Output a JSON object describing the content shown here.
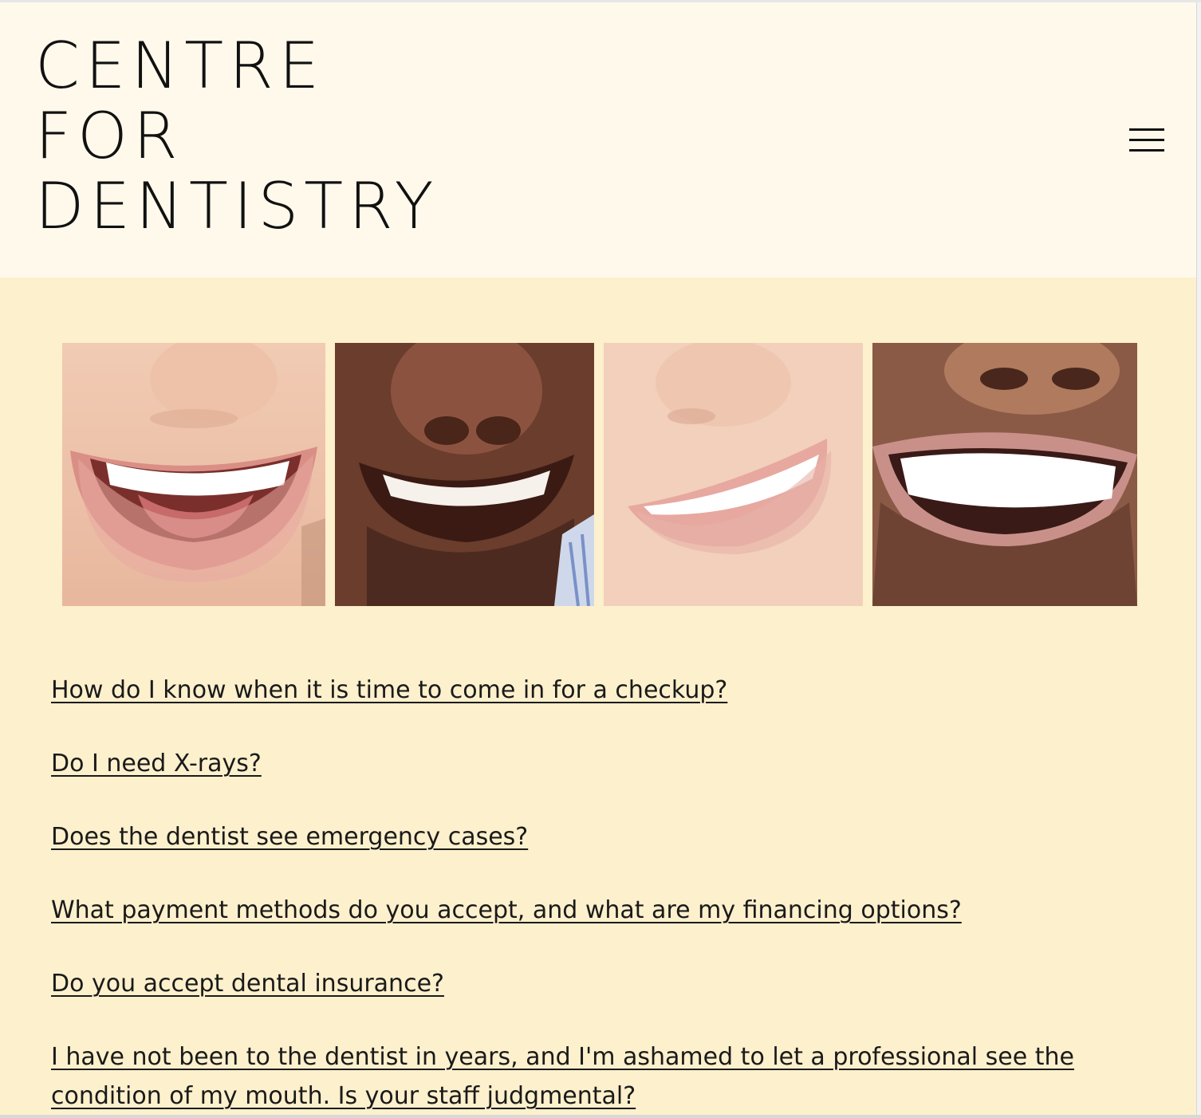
{
  "header": {
    "logo_lines": [
      "CENTRE",
      "FOR",
      "DENTISTRY"
    ]
  },
  "gallery": {
    "images": [
      {
        "subject": "smile-photo-1"
      },
      {
        "subject": "smile-photo-2"
      },
      {
        "subject": "smile-photo-3"
      },
      {
        "subject": "smile-photo-4"
      }
    ]
  },
  "faq": {
    "questions": [
      "How do I know when it is time to come in for a checkup?",
      "Do I need X-rays?",
      "Does the dentist see emergency cases?",
      "What payment methods do you accept, and what are my financing options?",
      "Do you accept dental insurance?",
      "I have not been to the dentist in years, and I'm ashamed to let a professional see the condition of my mouth. Is your staff judgmental?"
    ]
  },
  "colors": {
    "header_bg": "#fef9eb",
    "page_bg": "#fdf0cc",
    "text": "#111111"
  },
  "icons": {
    "menu": "hamburger-menu-icon"
  }
}
